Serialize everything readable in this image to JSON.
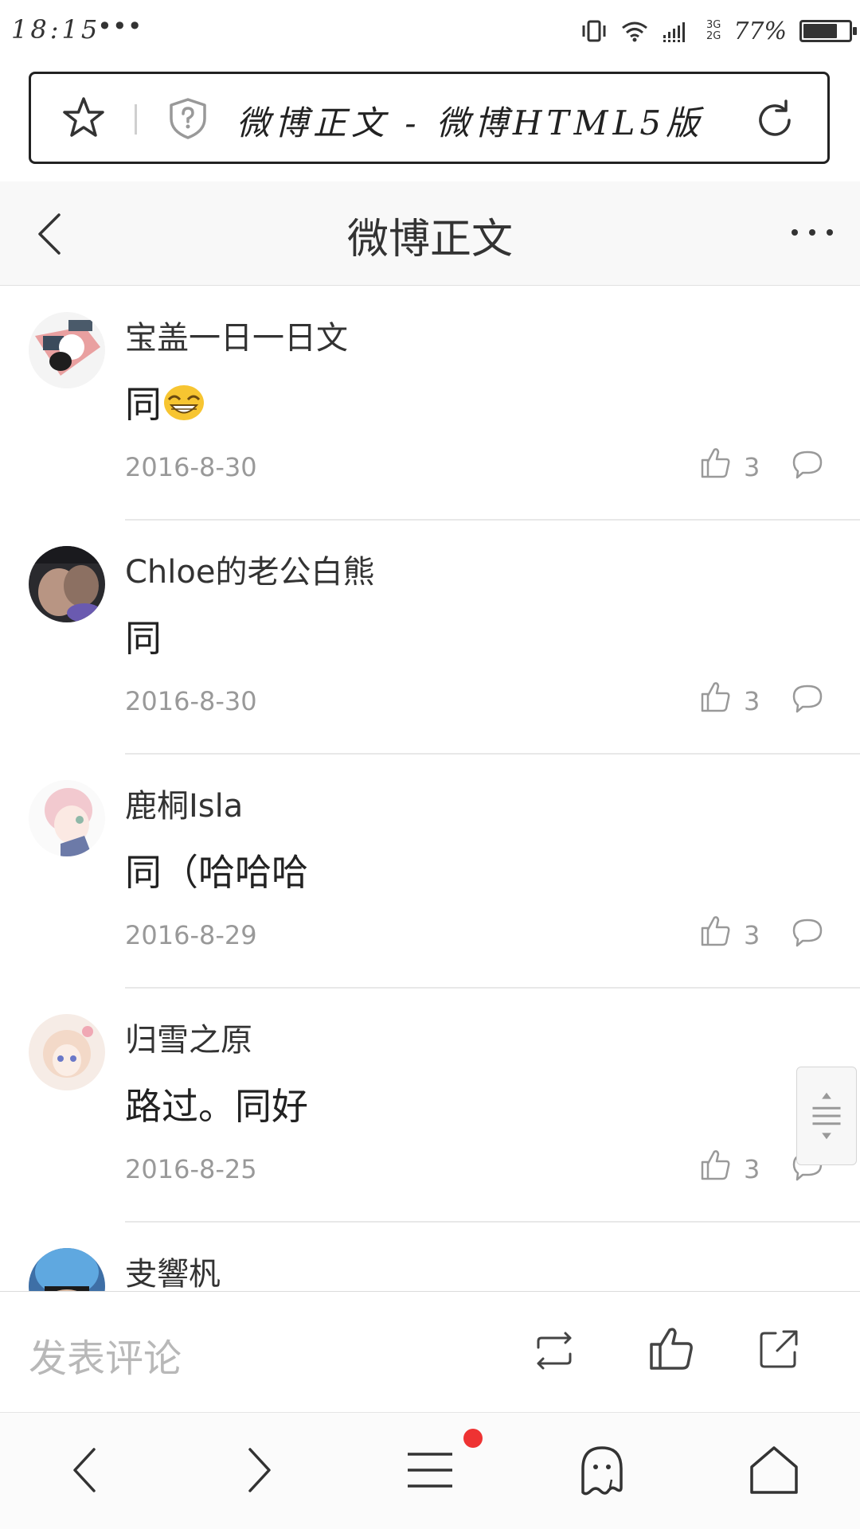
{
  "status_bar": {
    "time": "18:15",
    "dots": "•••",
    "network": [
      "3G",
      "2G"
    ],
    "battery_text": "77%",
    "battery_level": 0.77
  },
  "browser": {
    "url_title": "微博正文 - 微博HTML5版"
  },
  "header": {
    "title": "微博正文"
  },
  "comments": [
    {
      "name": "宝盖一日一日文",
      "text": "同",
      "has_emoji": true,
      "date": "2016-8-30",
      "likes": "3"
    },
    {
      "name": "Chloe的老公白熊",
      "text": "同",
      "has_emoji": false,
      "date": "2016-8-30",
      "likes": "3"
    },
    {
      "name": "鹿桐Isla",
      "text": "同（哈哈哈",
      "has_emoji": false,
      "date": "2016-8-29",
      "likes": "3"
    },
    {
      "name": "归雪之原",
      "text": "路过。同好",
      "has_emoji": false,
      "date": "2016-8-25",
      "likes": "3"
    },
    {
      "name": "叏響杋",
      "text": "",
      "has_emoji": false,
      "date": "",
      "likes": ""
    }
  ],
  "comment_bar": {
    "placeholder": "发表评论"
  },
  "colors": {
    "accent_dot": "#ee3333",
    "muted_text": "#999999",
    "header_bg": "#f8f8f8"
  },
  "icons": [
    "star-icon",
    "shield-icon",
    "reload-icon",
    "back-icon",
    "more-icon",
    "thumb-up-icon",
    "comment-icon",
    "repost-icon",
    "share-icon",
    "nav-back-icon",
    "nav-forward-icon",
    "menu-icon",
    "ghost-icon",
    "home-icon"
  ]
}
